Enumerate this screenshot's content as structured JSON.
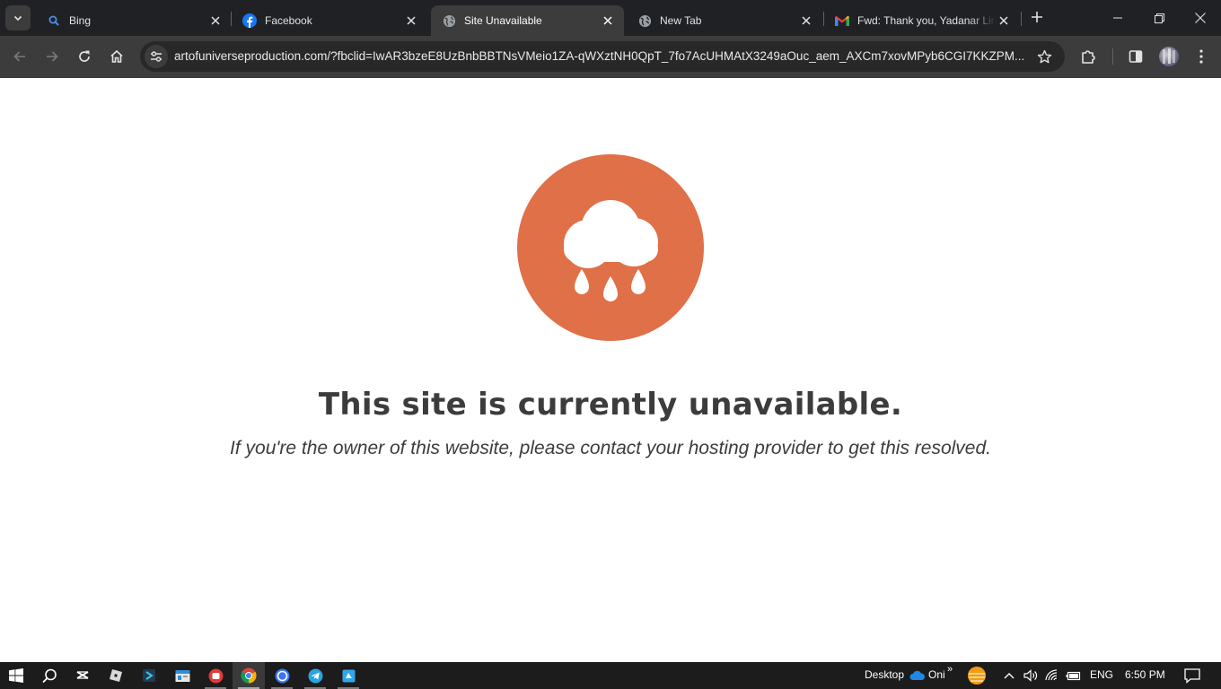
{
  "browser": {
    "tabs": [
      {
        "title": "Bing",
        "icon": "bing-search-icon",
        "active": false
      },
      {
        "title": "Facebook",
        "icon": "facebook-icon",
        "active": false
      },
      {
        "title": "Site Unavailable",
        "icon": "globe-icon",
        "active": true
      },
      {
        "title": "New Tab",
        "icon": "globe-icon",
        "active": false
      },
      {
        "title": "Fwd: Thank you, Yadanar Lin",
        "icon": "gmail-icon",
        "active": false
      }
    ],
    "url": "artofuniverseproduction.com/?fbclid=IwAR3bzeE8UzBnbBBTNsVMeio1ZA-qWXztNH0QpT_7fo7AcUHMAtX3249aOuc_aem_AXCm7xovMPyb6CGI7KKZPM..."
  },
  "page": {
    "icon": "rain-cloud-icon",
    "accent_color": "#e07048",
    "headline": "This site is currently unavailable.",
    "subline": "If you're the owner of this website, please contact your hosting provider to get this resolved."
  },
  "taskbar": {
    "apps": [
      "start-icon",
      "search-icon",
      "capcut-icon",
      "roblox-icon",
      "app-icon",
      "file-explorer-icon",
      "anydesk-icon",
      "chrome-icon",
      "signal-icon",
      "telegram-icon",
      "app-blue-icon"
    ],
    "desktop_label": "Desktop",
    "onedrive_label": "Oni",
    "language": "ENG",
    "time": "6:50 PM"
  }
}
